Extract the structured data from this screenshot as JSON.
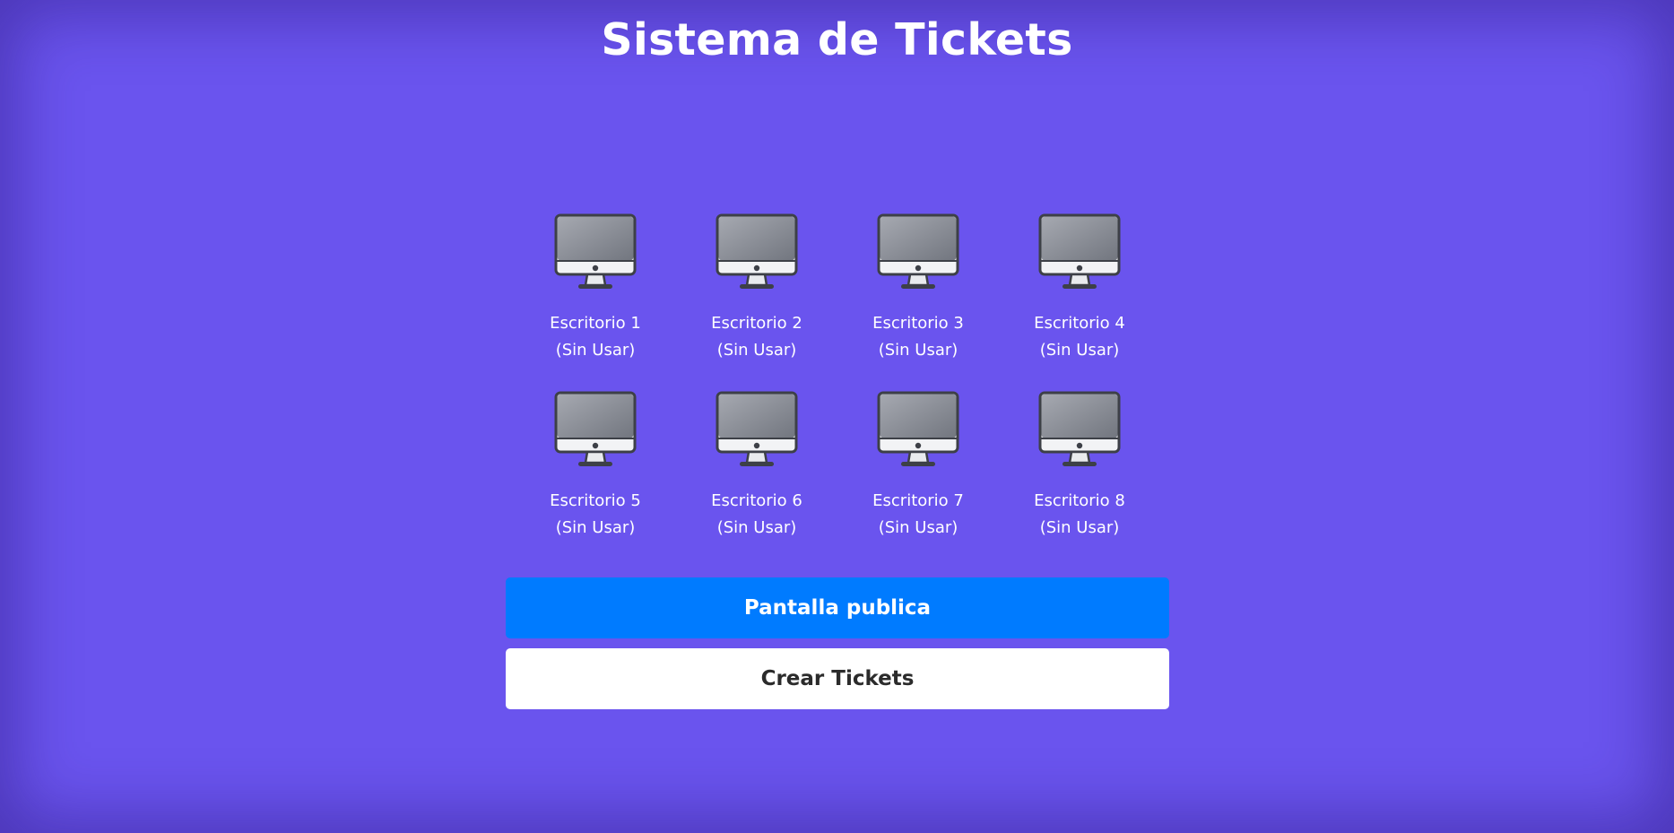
{
  "title": "Sistema de Tickets",
  "desks": [
    {
      "name": "Escritorio 1",
      "status": "(Sin Usar)",
      "icon": "desktop-monitor-icon"
    },
    {
      "name": "Escritorio 2",
      "status": "(Sin Usar)",
      "icon": "desktop-monitor-icon"
    },
    {
      "name": "Escritorio 3",
      "status": "(Sin Usar)",
      "icon": "desktop-monitor-icon"
    },
    {
      "name": "Escritorio 4",
      "status": "(Sin Usar)",
      "icon": "desktop-monitor-icon"
    },
    {
      "name": "Escritorio 5",
      "status": "(Sin Usar)",
      "icon": "desktop-monitor-icon"
    },
    {
      "name": "Escritorio 6",
      "status": "(Sin Usar)",
      "icon": "desktop-monitor-icon"
    },
    {
      "name": "Escritorio 7",
      "status": "(Sin Usar)",
      "icon": "desktop-monitor-icon"
    },
    {
      "name": "Escritorio 8",
      "status": "(Sin Usar)",
      "icon": "desktop-monitor-icon"
    }
  ],
  "buttons": {
    "public_screen": "Pantalla publica",
    "create_tickets": "Crear Tickets"
  },
  "colors": {
    "background": "#6a54ee",
    "primary_button": "#007bff",
    "secondary_button": "#ffffff",
    "text": "#ffffff"
  }
}
